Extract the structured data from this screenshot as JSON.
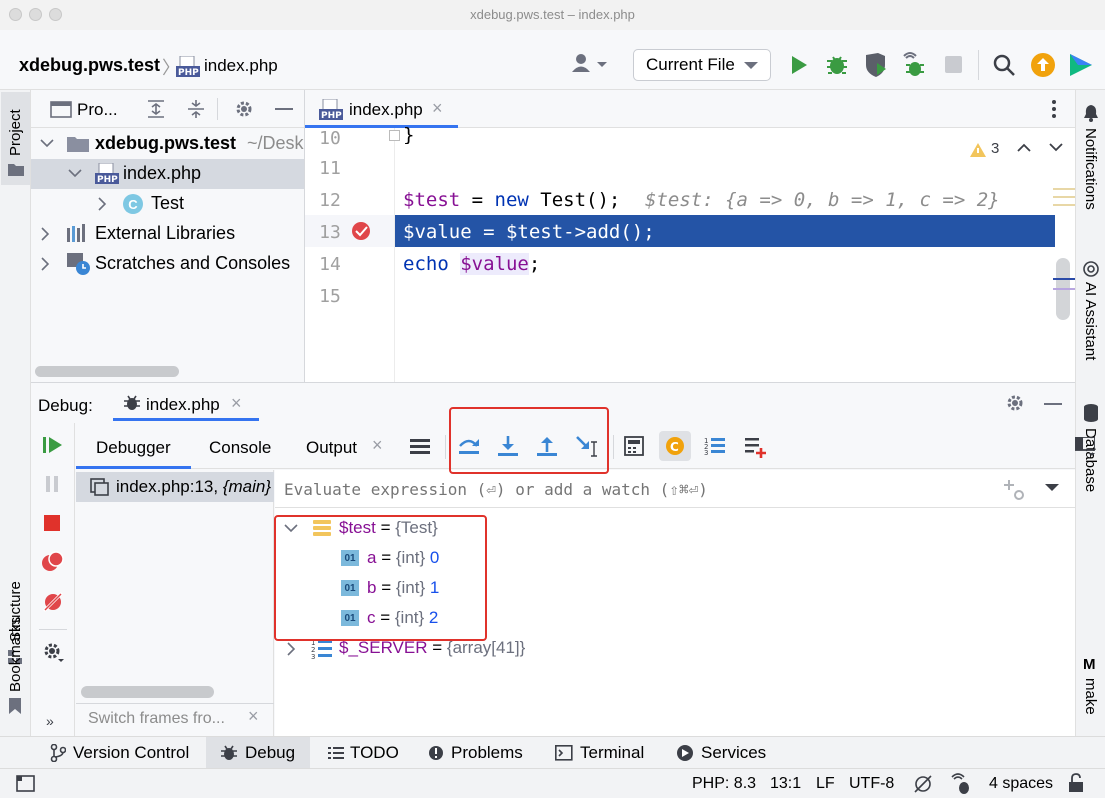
{
  "window": {
    "title": "xdebug.pws.test – index.php"
  },
  "navbar": {
    "project": "xdebug.pws.test",
    "file": "index.php",
    "run_config": "Current File"
  },
  "left_stripe": {
    "project_label": "Project",
    "structure_label": "Structure",
    "bookmarks_label": "Bookmarks"
  },
  "right_stripe": {
    "notifications_label": "Notifications",
    "ai_label": "AI Assistant",
    "database_label": "Database",
    "make_label": "make"
  },
  "project_panel": {
    "title": "Pro...",
    "tree": [
      {
        "label": "xdebug.pws.test",
        "hint": "~/Desk"
      },
      {
        "label": "index.php"
      },
      {
        "label": "Test"
      },
      {
        "label": "External Libraries"
      },
      {
        "label": "Scratches and Consoles"
      }
    ]
  },
  "editor": {
    "tab": "index.php",
    "warnings": "3",
    "lines": [
      {
        "num": "10",
        "code": "}"
      },
      {
        "num": "11",
        "code": ""
      },
      {
        "num": "12",
        "var": "$test",
        "rest1": " = ",
        "kw": "new",
        "rest2": " Test();",
        "inline": "$test: {a => 0, b => 1, c => 2}"
      },
      {
        "num": "13",
        "code": "$value = $test->add();"
      },
      {
        "num": "14",
        "kw": "echo",
        "var": "$value",
        "rest": ";"
      },
      {
        "num": "15",
        "code": ""
      }
    ]
  },
  "debug": {
    "label": "Debug:",
    "session_tab": "index.php",
    "tabs": [
      "Debugger",
      "Console",
      "Output"
    ],
    "frame": "index.php:13, ",
    "frame_italic": "{main}",
    "switch_frames": "Switch frames fro...",
    "eval_placeholder": "Evaluate expression (⏎) or add a watch (⇧⌘⏎)",
    "variables": [
      {
        "name": "$test",
        "eq": " = ",
        "type": "{Test}"
      },
      {
        "name": "a",
        "eq": " = ",
        "type": "{int}",
        "value": "0"
      },
      {
        "name": "b",
        "eq": " = ",
        "type": "{int}",
        "value": "1"
      },
      {
        "name": "c",
        "eq": " = ",
        "type": "{int}",
        "value": "2"
      },
      {
        "name": "$_SERVER",
        "eq": " = ",
        "type": "{array[41]}"
      }
    ]
  },
  "bottom_tools": [
    "Version Control",
    "Debug",
    "TODO",
    "Problems",
    "Terminal",
    "Services"
  ],
  "status": {
    "php": "PHP: 8.3",
    "pos": "13:1",
    "eol": "LF",
    "encoding": "UTF-8",
    "indent": "4 spaces"
  },
  "colors": {
    "accent": "#2151a8",
    "var": "#871094",
    "keyword": "#0033b3",
    "highlight": "#2454a6",
    "red": "#e0322b",
    "green": "#3a9b42"
  }
}
